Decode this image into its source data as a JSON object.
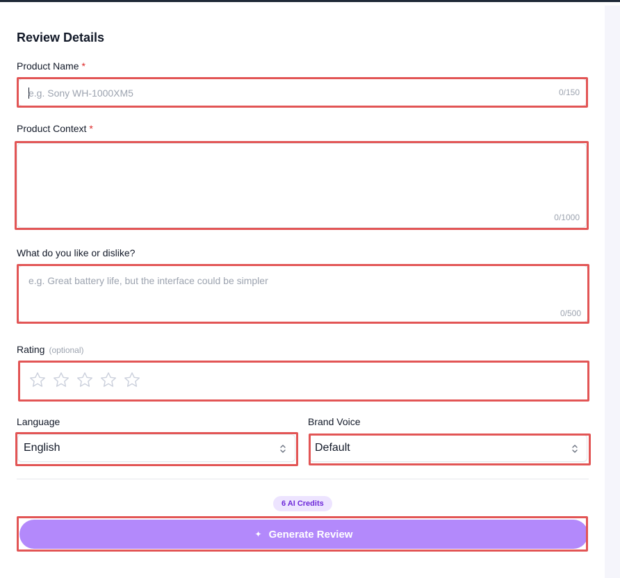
{
  "form": {
    "title": "Review Details",
    "product_name": {
      "label": "Product Name",
      "required_mark": "*",
      "placeholder": "e.g. Sony WH-1000XM5",
      "counter": "0/150"
    },
    "product_context": {
      "label": "Product Context",
      "required_mark": "*",
      "counter": "0/1000"
    },
    "likes_dislikes": {
      "label": "What do you like or dislike?",
      "placeholder": "e.g. Great battery life, but the interface could be simpler",
      "counter": "0/500"
    },
    "rating": {
      "label": "Rating",
      "optional": "(optional)",
      "max_stars": 5,
      "value": 0
    },
    "language": {
      "label": "Language",
      "selected": "English"
    },
    "brand_voice": {
      "label": "Brand Voice",
      "selected": "Default"
    },
    "credits_badge": "6 AI Credits",
    "generate_button": {
      "icon": "sparkle-icon",
      "label": "Generate Review"
    }
  },
  "colors": {
    "accent": "#b389fb",
    "badge_bg": "#ede4ff",
    "badge_text": "#6d28d9",
    "required": "#dc2626",
    "highlight": "#e25555"
  }
}
